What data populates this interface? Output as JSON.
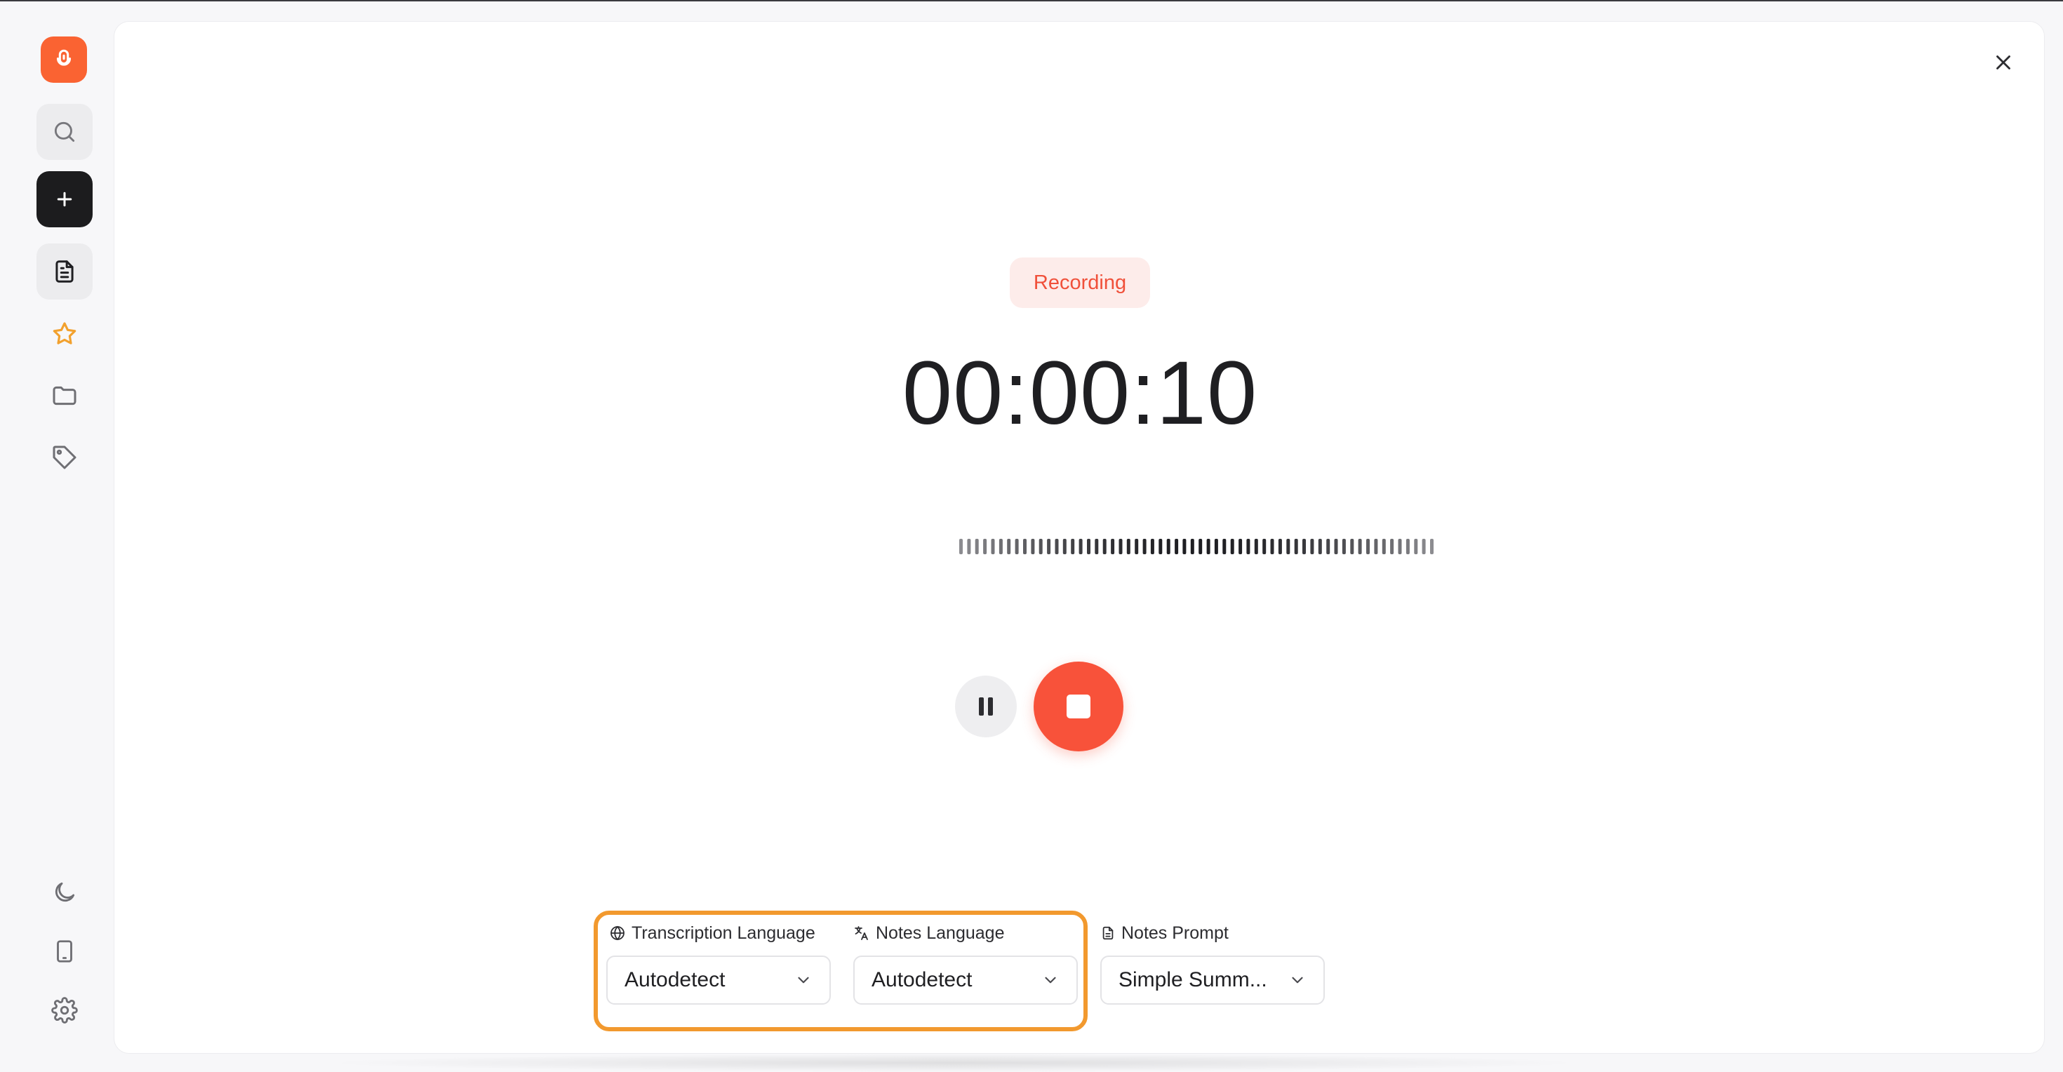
{
  "sidebar": {
    "logo_icon": "microphone-icon",
    "items": [
      {
        "name": "search",
        "icon": "search-icon"
      },
      {
        "name": "new-recording",
        "icon": "plus-icon"
      },
      {
        "name": "notes",
        "icon": "document-icon"
      },
      {
        "name": "favorites",
        "icon": "star-icon"
      },
      {
        "name": "folders",
        "icon": "folder-icon"
      },
      {
        "name": "tags",
        "icon": "tag-icon"
      },
      {
        "name": "theme",
        "icon": "moon-icon"
      },
      {
        "name": "mobile",
        "icon": "phone-icon"
      },
      {
        "name": "settings",
        "icon": "gear-icon"
      }
    ],
    "accent_color": "#fa6332",
    "star_color": "#f2a12e"
  },
  "recorder": {
    "status": "Recording",
    "timer": "00:00:10",
    "stop_color": "#f8523a",
    "waveform_bars": 60
  },
  "options": {
    "transcription_language": {
      "label": "Transcription Language",
      "value": "Autodetect"
    },
    "notes_language": {
      "label": "Notes Language",
      "value": "Autodetect"
    },
    "notes_prompt": {
      "label": "Notes Prompt",
      "value": "Simple Summ..."
    },
    "highlight_color": "#f2992e"
  }
}
